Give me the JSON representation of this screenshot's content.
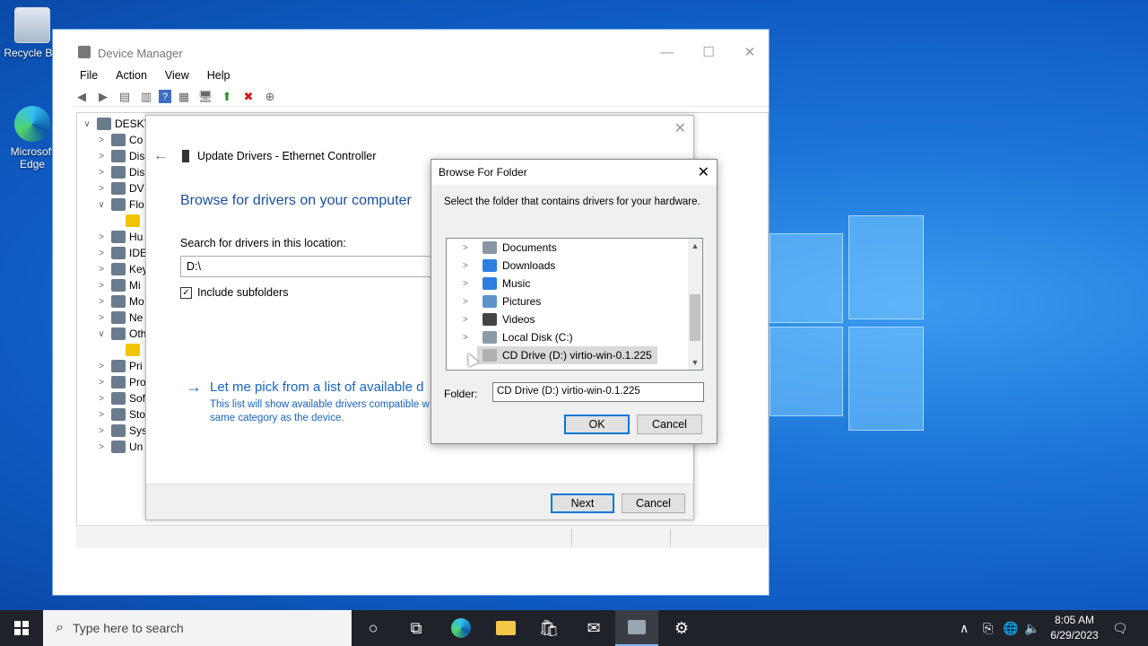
{
  "desktop": {
    "icons": [
      {
        "label": "Recycle Bin"
      },
      {
        "label": "Microsoft Edge"
      }
    ]
  },
  "device_manager": {
    "title": "Device Manager",
    "menu": [
      "File",
      "Action",
      "View",
      "Help"
    ],
    "tree": [
      {
        "label": "DESKTOP",
        "expanded": true,
        "chev": "∨"
      },
      {
        "label": "Co",
        "chev": ">"
      },
      {
        "label": "Dis",
        "chev": ">"
      },
      {
        "label": "Dis",
        "chev": ">"
      },
      {
        "label": "DV",
        "chev": ">"
      },
      {
        "label": "Flo",
        "chev": "∨"
      },
      {
        "label": "",
        "chev": ""
      },
      {
        "label": "Hu",
        "chev": ">"
      },
      {
        "label": "IDE",
        "chev": ">"
      },
      {
        "label": "Key",
        "chev": ">"
      },
      {
        "label": "Mi",
        "chev": ">"
      },
      {
        "label": "Mo",
        "chev": ">"
      },
      {
        "label": "Ne",
        "chev": ">"
      },
      {
        "label": "Oth",
        "chev": "∨"
      },
      {
        "label": "",
        "chev": ""
      },
      {
        "label": "Pri",
        "chev": ">"
      },
      {
        "label": "Pro",
        "chev": ">"
      },
      {
        "label": "Sof",
        "chev": ">"
      },
      {
        "label": "Sto",
        "chev": ">"
      },
      {
        "label": "Sys",
        "chev": ">"
      },
      {
        "label": "Un",
        "chev": ">"
      }
    ]
  },
  "update_drivers": {
    "header": "Update Drivers - Ethernet Controller",
    "heading": "Browse for drivers on your computer",
    "search_label": "Search for drivers in this location:",
    "path_value": "D:\\",
    "include_subfolders": "Include subfolders",
    "pick_link": "Let me pick from a list of available d",
    "pick_desc": "This list will show available drivers compatible w same category as the device.",
    "next": "Next",
    "cancel": "Cancel"
  },
  "browse_folder": {
    "title": "Browse For Folder",
    "instruction": "Select the folder that contains drivers for your hardware.",
    "items": [
      {
        "label": "Documents",
        "icon": "documents-icon",
        "color": "#8a96a6"
      },
      {
        "label": "Downloads",
        "icon": "downloads-icon",
        "color": "#2c7fe0"
      },
      {
        "label": "Music",
        "icon": "music-icon",
        "color": "#2c7fe0"
      },
      {
        "label": "Pictures",
        "icon": "pictures-icon",
        "color": "#5d93c9"
      },
      {
        "label": "Videos",
        "icon": "videos-icon",
        "color": "#444444"
      },
      {
        "label": "Local Disk (C:)",
        "icon": "local-disk-icon",
        "color": "#8a9aa6"
      },
      {
        "label": "CD Drive (D:) virtio-win-0.1.225",
        "icon": "cd-drive-icon",
        "color": "#b0b0b0",
        "selected": true
      }
    ],
    "folder_label": "Folder:",
    "folder_value": "CD Drive (D:) virtio-win-0.1.225",
    "ok": "OK",
    "cancel": "Cancel"
  },
  "taskbar": {
    "search_placeholder": "Type here to search",
    "time": "8:05 AM",
    "date": "6/29/2023"
  }
}
